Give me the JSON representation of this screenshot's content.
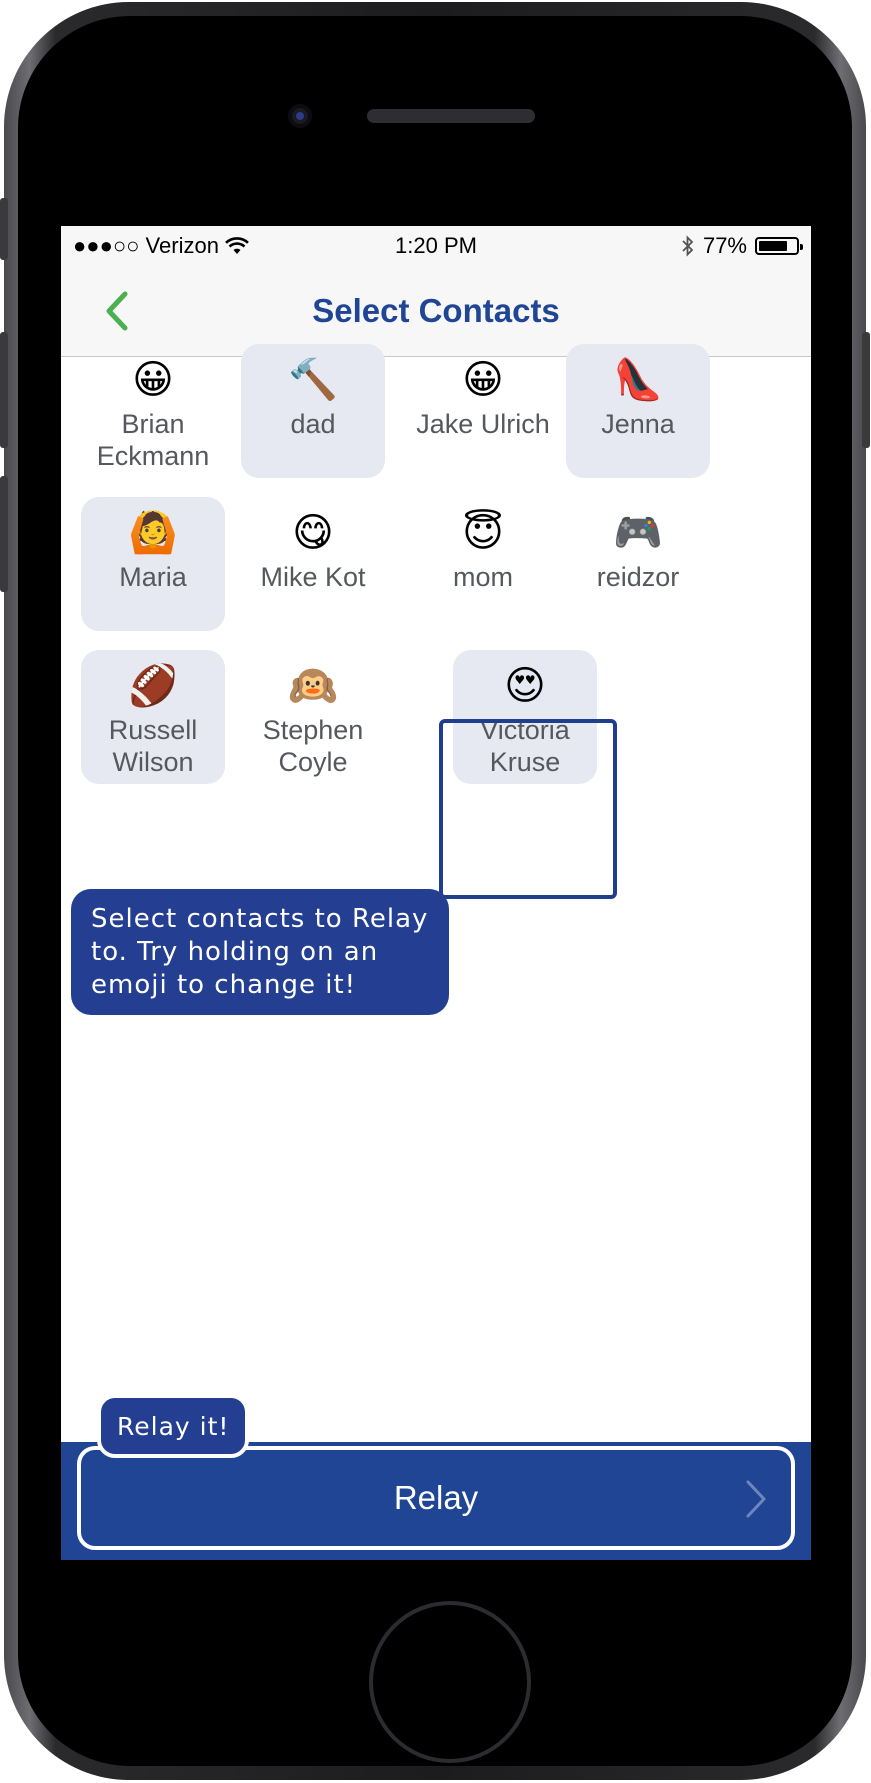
{
  "status_bar": {
    "carrier": "●●●○○ Verizon",
    "time": "1:20 PM",
    "battery_percent": "77%",
    "battery_level": 0.77
  },
  "nav": {
    "title": "Select Contacts",
    "back_icon": "chevron-left-icon",
    "accent_color": "#4caf50"
  },
  "contacts": [
    {
      "emoji": "😀",
      "name": "Brian Eckmann",
      "selected": false
    },
    {
      "emoji": "🔨",
      "name": "dad",
      "selected": true
    },
    {
      "emoji": "😀",
      "name": "Jake Ulrich",
      "selected": false
    },
    {
      "emoji": "👠",
      "name": "Jenna",
      "selected": true
    },
    {
      "emoji": "🙆",
      "name": "Maria",
      "selected": true
    },
    {
      "emoji": "😋",
      "name": "Mike Kot",
      "selected": false
    },
    {
      "emoji": "😇",
      "name": "mom",
      "selected": false
    },
    {
      "emoji": "🎮",
      "name": "reidzor",
      "selected": false
    },
    {
      "emoji": "🏈",
      "name": "Russell Wilson",
      "selected": true
    },
    {
      "emoji": "🙉",
      "name": "Stephen Coyle",
      "selected": false
    },
    {
      "emoji": "😍",
      "name": "Victoria Kruse",
      "selected": true
    }
  ],
  "tooltip": {
    "text": "Select contacts to Relay to. Try holding on an emoji to change it!"
  },
  "relay": {
    "button_label": "Relay",
    "tip_label": "Relay it!",
    "brand_color": "#1f4594"
  }
}
